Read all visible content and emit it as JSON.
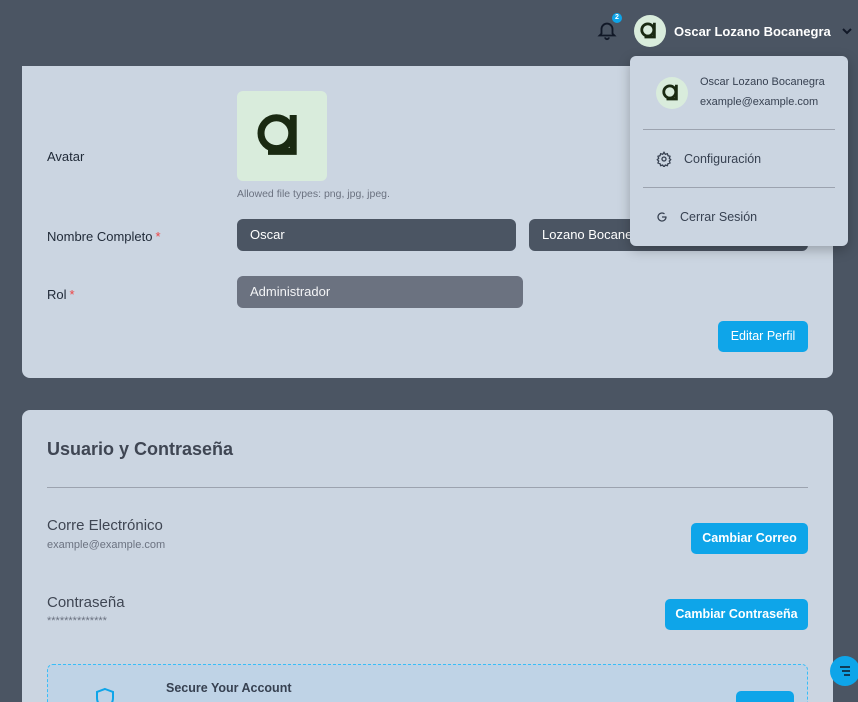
{
  "header": {
    "notification_count": "2",
    "user_name": "Oscar Lozano Bocanegra"
  },
  "profile": {
    "avatar_label": "Avatar",
    "avatar_hint": "Allowed file types: png, jpg, jpeg.",
    "fullname_label": "Nombre Completo",
    "first_name": "Oscar",
    "last_name": "Lozano Bocanegra",
    "role_label": "Rol",
    "role_value": "Administrador",
    "required_mark": "*",
    "edit_button": "Editar Perfil"
  },
  "credentials": {
    "title": "Usuario y Contraseña",
    "email_title": "Corre Electrónico",
    "email_value": "example@example.com",
    "change_email_button": "Cambiar Correo",
    "password_title": "Contraseña",
    "password_value": "**************",
    "change_password_button": "Cambiar Contraseña",
    "secure_title": "Secure Your Account"
  },
  "dropdown": {
    "name": "Oscar Lozano Bocanegra",
    "email": "example@example.com",
    "settings_label": "Configuración",
    "logout_label": "Cerrar Sesión"
  },
  "colors": {
    "accent": "#0ea5e9",
    "background": "#4b5563",
    "card": "#cbd5e1",
    "required": "#ef4444"
  }
}
